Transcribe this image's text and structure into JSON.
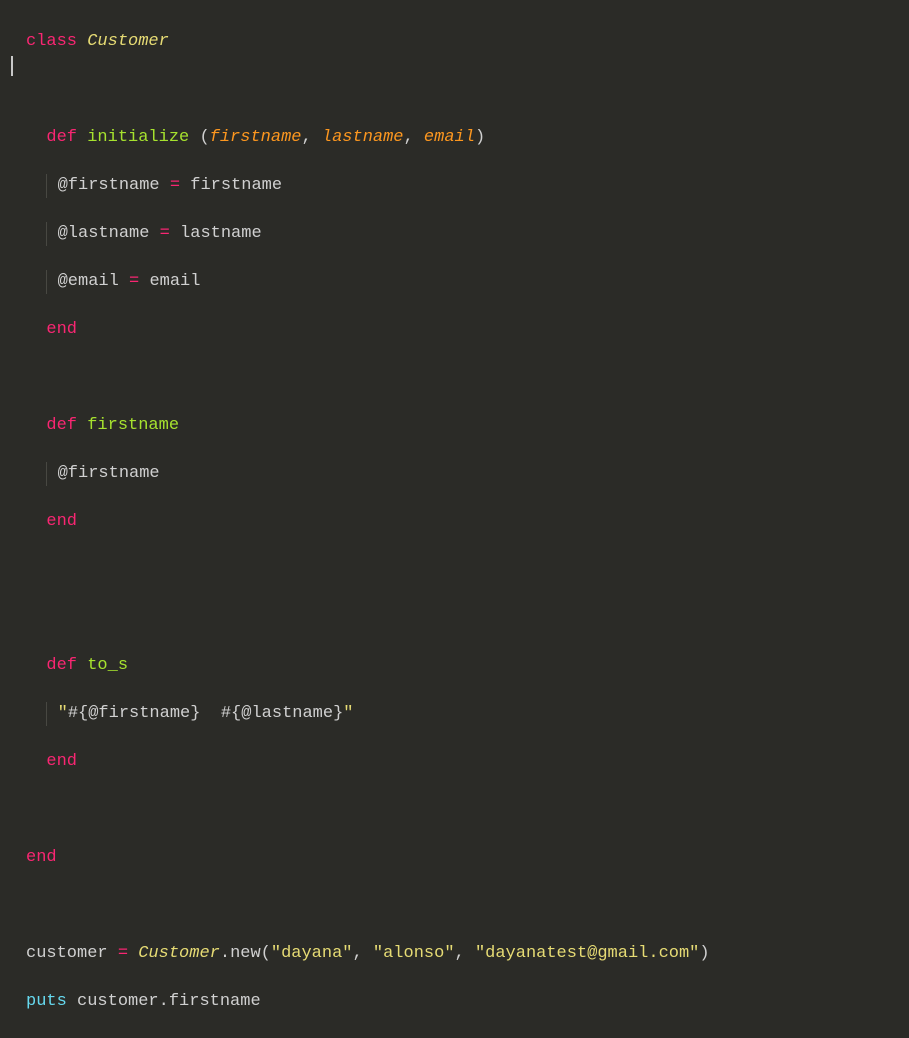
{
  "code": {
    "line1": {
      "kw": "class",
      "name": "Customer"
    },
    "line3": {
      "kw": "def",
      "method": "initialize",
      "p1": "firstname",
      "p2": "lastname",
      "p3": "email"
    },
    "line4": {
      "ivar": "@firstname",
      "op": "=",
      "val": "firstname"
    },
    "line5": {
      "ivar": "@lastname",
      "op": "=",
      "val": "lastname"
    },
    "line6": {
      "ivar": "@email",
      "op": "=",
      "val": "email"
    },
    "line7": {
      "kw": "end"
    },
    "line9": {
      "kw": "def",
      "method": "firstname"
    },
    "line10": {
      "ivar": "@firstname"
    },
    "line11": {
      "kw": "end"
    },
    "line14": {
      "kw": "def",
      "method": "to_s"
    },
    "line15": {
      "q1": "\"",
      "interp1a": "#{",
      "ivar1": "@firstname",
      "interp1b": "}",
      "space": "  ",
      "interp2a": "#{",
      "ivar2": "@lastname",
      "interp2b": "}",
      "q2": "\""
    },
    "line16": {
      "kw": "end"
    },
    "line18": {
      "kw": "end"
    },
    "line20": {
      "var": "customer",
      "op": "=",
      "cls": "Customer",
      "dot": ".",
      "method": "new",
      "s1": "\"dayana\"",
      "s2": "\"alonso\"",
      "s3": "\"dayanatest@gmail.com\""
    },
    "line21": {
      "kw": "puts",
      "var": "customer",
      "dot": ".",
      "prop": "firstname"
    }
  }
}
